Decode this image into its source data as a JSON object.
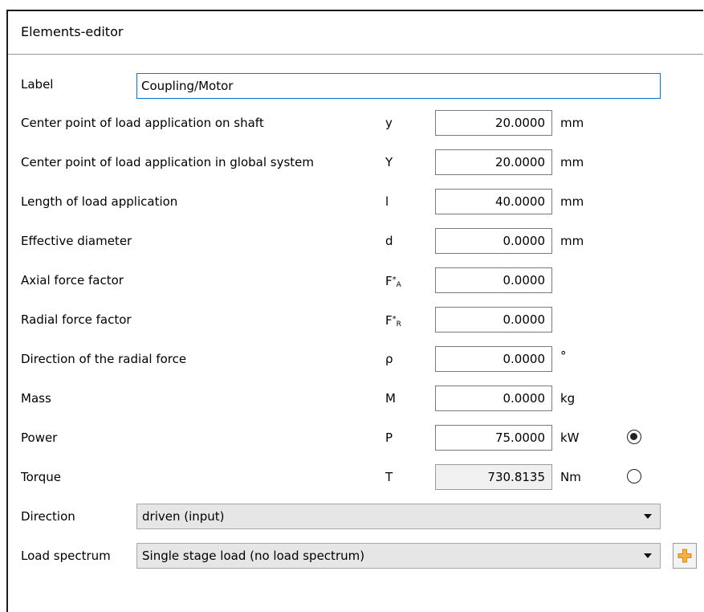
{
  "window": {
    "title": "Elements-editor"
  },
  "label_field": {
    "label": "Label",
    "value": "Coupling/Motor"
  },
  "fields": [
    {
      "label": "Center point of load application on shaft",
      "symbol": "y",
      "value": "20.0000",
      "unit": "mm"
    },
    {
      "label": "Center point of load application in global system",
      "symbol": "Y",
      "value": "20.0000",
      "unit": "mm"
    },
    {
      "label": "Length of load application",
      "symbol": "l",
      "value": "40.0000",
      "unit": "mm"
    },
    {
      "label": "Effective diameter",
      "symbol": "d",
      "value": "0.0000",
      "unit": "mm"
    },
    {
      "label": "Axial force factor",
      "symbol": "F",
      "symbol_sup": "*",
      "symbol_sub": "A",
      "value": "0.0000",
      "unit": ""
    },
    {
      "label": "Radial force factor",
      "symbol": "F",
      "symbol_sup": "*",
      "symbol_sub": "R",
      "value": "0.0000",
      "unit": ""
    },
    {
      "label": "Direction of the radial force",
      "symbol": "ρ",
      "value": "0.0000",
      "unit": "°"
    },
    {
      "label": "Mass",
      "symbol": "M",
      "value": "0.0000",
      "unit": "kg"
    },
    {
      "label": "Power",
      "symbol": "P",
      "value": "75.0000",
      "unit": "kW",
      "radio_selected": true
    },
    {
      "label": "Torque",
      "symbol": "T",
      "value": "730.8135",
      "unit": "Nm",
      "radio_selected": false,
      "readonly": true
    }
  ],
  "direction": {
    "label": "Direction",
    "selected": "driven (input)"
  },
  "load_spectrum": {
    "label": "Load spectrum",
    "selected": "Single stage load (no load spectrum)"
  },
  "icons": {
    "add": "plus-icon",
    "add_color": "#f5a623"
  }
}
